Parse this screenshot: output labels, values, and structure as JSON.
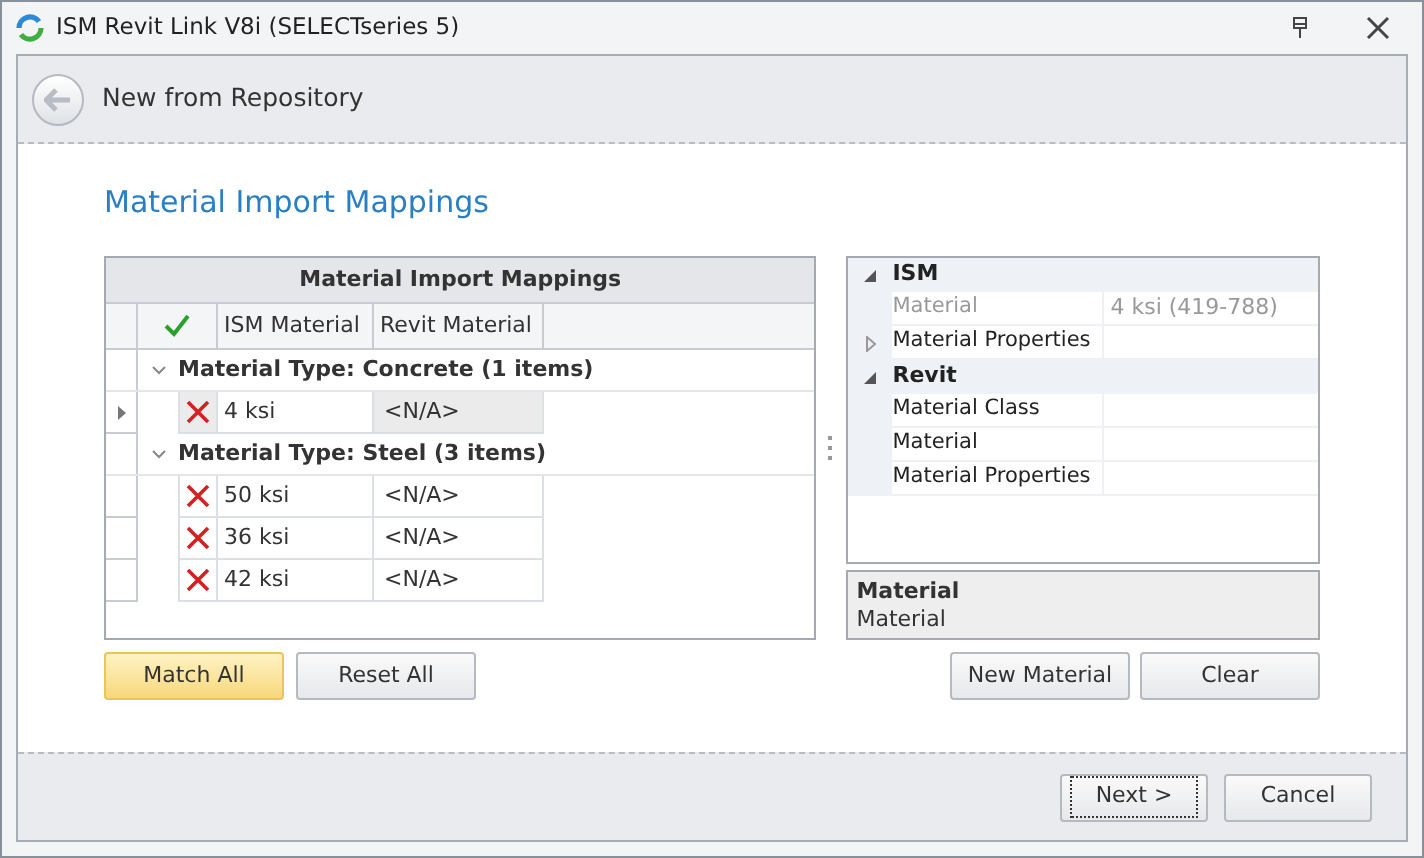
{
  "window": {
    "title": "ISM Revit Link V8i (SELECTseries 5)"
  },
  "header": {
    "title": "New from Repository"
  },
  "section_title": "Material Import Mappings",
  "grid": {
    "title": "Material Import Mappings",
    "columns": [
      "ISM Material",
      "Revit Material"
    ],
    "groups": [
      {
        "label": "Material Type: Concrete (1 items)",
        "expanded": true,
        "rows": [
          {
            "ism": "4 ksi",
            "revit": "<N/A>",
            "matched": false,
            "selected": true
          }
        ]
      },
      {
        "label": "Material Type: Steel (3 items)",
        "expanded": true,
        "rows": [
          {
            "ism": "50 ksi",
            "revit": "<N/A>",
            "matched": false,
            "selected": false
          },
          {
            "ism": "36 ksi",
            "revit": "<N/A>",
            "matched": false,
            "selected": false
          },
          {
            "ism": "42 ksi",
            "revit": "<N/A>",
            "matched": false,
            "selected": false
          }
        ]
      }
    ]
  },
  "properties": {
    "categories": [
      {
        "label": "ISM",
        "expanded": true,
        "items": [
          {
            "label": "Material",
            "value": "4 ksi (419-788)",
            "readonly": true
          },
          {
            "label": "Material Properties",
            "readonly": false,
            "expanded": false
          }
        ]
      },
      {
        "label": "Revit",
        "expanded": true,
        "items": [
          {
            "label": "Material Class",
            "readonly": false
          },
          {
            "label": "Material",
            "readonly": false
          },
          {
            "label": "Material Properties",
            "readonly": false
          }
        ]
      }
    ]
  },
  "description": {
    "title": "Material",
    "text": "Material"
  },
  "left_buttons": [
    {
      "label": "Match All",
      "highlighted": true
    },
    {
      "label": "Reset All",
      "highlighted": false
    }
  ],
  "right_buttons": [
    {
      "label": "New Material",
      "highlighted": false
    },
    {
      "label": "Clear",
      "highlighted": false
    }
  ],
  "footer_buttons": [
    {
      "label": "Next >",
      "focused": true
    },
    {
      "label": "Cancel",
      "focused": false
    }
  ]
}
